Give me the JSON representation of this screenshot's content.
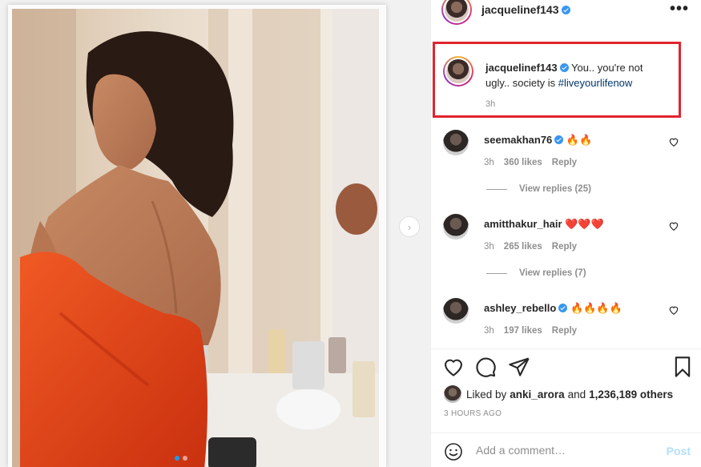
{
  "post": {
    "author": "jacquelinef143",
    "more_glyph": "•••",
    "carousel_dots": 2,
    "carousel_active": 1
  },
  "caption": {
    "username": "jacquelinef143",
    "text": "You.. you're not ugly.. society is ",
    "hashtag": "#liveyourlifenow",
    "time": "3h"
  },
  "comments": [
    {
      "username": "seemakhan76",
      "emoji": "🔥🔥",
      "time": "3h",
      "likes": "360 likes",
      "reply": "Reply",
      "view_replies": "View replies (25)"
    },
    {
      "username": "amitthakur_hair",
      "emoji": "❤️❤️❤️",
      "time": "3h",
      "likes": "265 likes",
      "reply": "Reply",
      "view_replies": "View replies (7)"
    },
    {
      "username": "ashley_rebello",
      "emoji": "🔥🔥🔥🔥",
      "time": "3h",
      "likes": "197 likes",
      "reply": "Reply",
      "view_replies": ""
    }
  ],
  "likes": {
    "prefix": "Liked by",
    "user": "anki_arora",
    "connector": "and",
    "others": "1,236,189 others"
  },
  "time_ago": "3 HOURS AGO",
  "add_comment": {
    "placeholder": "Add a comment…",
    "post_label": "Post"
  },
  "colors": {
    "highlight_border": "#e0242f",
    "verified": "#3897f0",
    "hashtag": "#00376b",
    "post_disabled": "#b2dffc",
    "towel": "#e0401c"
  }
}
